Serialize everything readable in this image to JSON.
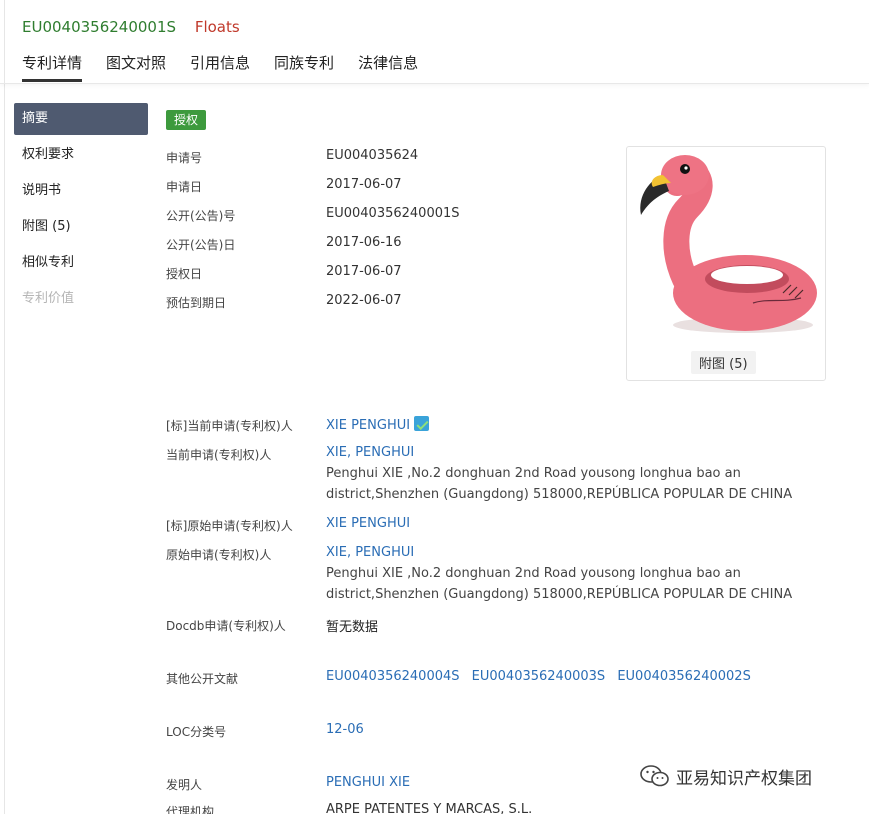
{
  "header": {
    "publication_number": "EU0040356240001S",
    "title": "Floats",
    "tabs": [
      "专利详情",
      "图文对照",
      "引用信息",
      "同族专利",
      "法律信息"
    ]
  },
  "sidebar": {
    "items": [
      {
        "label": "摘要",
        "state": "active"
      },
      {
        "label": "权利要求",
        "state": "normal"
      },
      {
        "label": "说明书",
        "state": "normal"
      },
      {
        "label": "附图 (5)",
        "state": "normal"
      },
      {
        "label": "相似专利",
        "state": "normal"
      },
      {
        "label": "专利价值",
        "state": "disabled"
      }
    ]
  },
  "main": {
    "status_badge": "授权",
    "status_color": "#3d9a3d",
    "basic_fields": [
      {
        "label": "申请号",
        "value": "EU004035624"
      },
      {
        "label": "申请日",
        "value": "2017-06-07"
      },
      {
        "label": "公开(公告)号",
        "value": "EU0040356240001S"
      },
      {
        "label": "公开(公告)日",
        "value": "2017-06-16"
      },
      {
        "label": "授权日",
        "value": "2017-06-07"
      },
      {
        "label": "预估到期日",
        "value": "2022-06-07"
      }
    ],
    "thumbnail_caption": "附图 (5)",
    "std_current_applicant_label": "[标]当前申请(专利权)人",
    "std_current_applicant_value": "XIE PENGHUI",
    "current_applicant_label": "当前申请(专利权)人",
    "current_applicant_value": "XIE, PENGHUI",
    "current_applicant_addr_1": "Penghui XIE ,No.2 donghuan 2nd Road yousong longhua bao an",
    "current_applicant_addr_2": "district,Shenzhen (Guangdong) 518000,REPÚBLICA POPULAR DE CHINA",
    "std_original_applicant_label": "[标]原始申请(专利权)人",
    "std_original_applicant_value": "XIE PENGHUI",
    "original_applicant_label": "原始申请(专利权)人",
    "original_applicant_value": "XIE, PENGHUI",
    "original_applicant_addr_1": "Penghui XIE ,No.2 donghuan 2nd Road yousong longhua bao an",
    "original_applicant_addr_2": "district,Shenzhen (Guangdong) 518000,REPÚBLICA POPULAR DE CHINA",
    "docdb_label": "Docdb申请(专利权)人",
    "docdb_value": "暂无数据",
    "other_pub_label": "其他公开文献",
    "other_pub_values": [
      "EU0040356240004S",
      "EU0040356240003S",
      "EU0040356240002S"
    ],
    "loc_label": "LOC分类号",
    "loc_value": "12-06",
    "inventor_label": "发明人",
    "inventor_value": "PENGHUI XIE",
    "agency_label": "代理机构",
    "agency_value": "ARPE PATENTES Y MARCAS, S.L."
  },
  "watermark": {
    "text": "亚易知识产权集团",
    "icon": "wechat-icon"
  },
  "colors": {
    "accent_green": "#2f7d2f",
    "title_red": "#c0392b",
    "link_blue": "#2a6db5",
    "sidebar_active": "#4f5a70"
  }
}
